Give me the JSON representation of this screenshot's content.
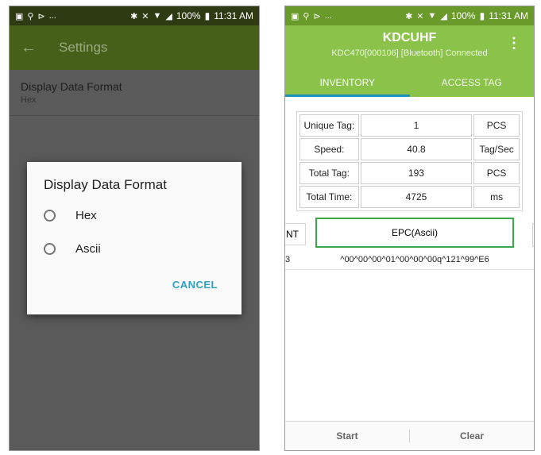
{
  "status_bar": {
    "left_icons": [
      "▣",
      "⚲",
      "⊳",
      "..."
    ],
    "right_icons": [
      "✱",
      "✕",
      "▼",
      "◢"
    ],
    "battery": "100%",
    "time": "11:31 AM"
  },
  "settings_screen": {
    "title": "Settings",
    "pref_item": {
      "title": "Display Data Format",
      "value": "Hex"
    },
    "dialog": {
      "title": "Display Data Format",
      "options": [
        "Hex",
        "Ascii"
      ],
      "cancel_label": "CANCEL"
    }
  },
  "main_screen": {
    "app_title": "KDCUHF",
    "connection": "KDC470[000106] [Bluetooth] Connected",
    "tabs": [
      "INVENTORY",
      "ACCESS TAG"
    ],
    "stats": [
      {
        "label": "Unique Tag:",
        "value": "1",
        "unit": "PCS"
      },
      {
        "label": "Speed:",
        "value": "40.8",
        "unit": "Tag/Sec"
      },
      {
        "label": "Total Tag:",
        "value": "193",
        "unit": "PCS"
      },
      {
        "label": "Total Time:",
        "value": "4725",
        "unit": "ms"
      }
    ],
    "columns": {
      "count_fragment": "NT",
      "epc": "EPC(Ascii)"
    },
    "rows": [
      {
        "count": "3",
        "epc": "^00^00^00^01^00^00^00q^121^99^E6"
      }
    ],
    "buttons": {
      "start": "Start",
      "clear": "Clear"
    }
  },
  "colors": {
    "accent_green": "#8bc34a",
    "tab_indicator": "#1c8fbd",
    "highlight_box": "#3aa84a",
    "dialog_action": "#2ea0c4"
  }
}
